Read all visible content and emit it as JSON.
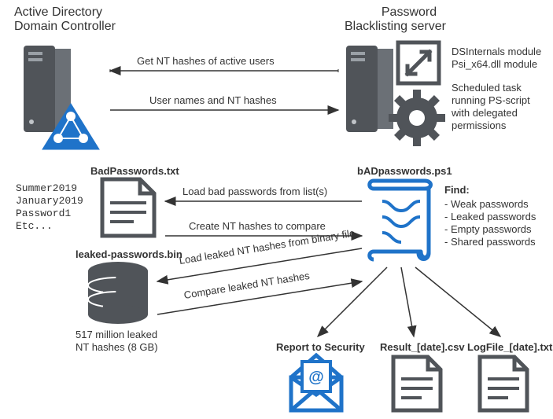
{
  "titles": {
    "adDc1": "Active Directory",
    "adDc2": "Domain Controller",
    "pbs1": "Password",
    "pbs2": "Blacklisting server"
  },
  "serverNotes": {
    "l1": "DSInternals module",
    "l2": "Psi_x64.dll module",
    "l3": "Scheduled task",
    "l4": "running PS-script",
    "l5": "with delegated",
    "l6": "permissions"
  },
  "arrows": {
    "getHashes": "Get NT hashes of active users",
    "userNames": "User names and NT hashes",
    "loadBad": "Load bad passwords from list(s)",
    "createHashes": "Create NT hashes to compare",
    "loadLeaked": "Load leaked NT hashes from binary file",
    "compareLeaked": "Compare leaked NT hashes"
  },
  "files": {
    "badTxt": "BadPasswords.txt",
    "bad1": "Summer2019",
    "bad2": "January2019",
    "bad3": "Password1",
    "bad4": "Etc...",
    "leakedBin": "leaked-passwords.bin",
    "leakedNote1": "517 million leaked",
    "leakedNote2": "NT hashes (8 GB)",
    "script": "bADpasswords.ps1"
  },
  "find": {
    "head": "Find:",
    "i1": "- Weak passwords",
    "i2": "- Leaked passwords",
    "i3": "- Empty passwords",
    "i4": "- Shared passwords"
  },
  "outputs": {
    "o1": "Report to Security",
    "o2": "Result_[date].csv",
    "o3": "LogFile_[date].txt"
  }
}
